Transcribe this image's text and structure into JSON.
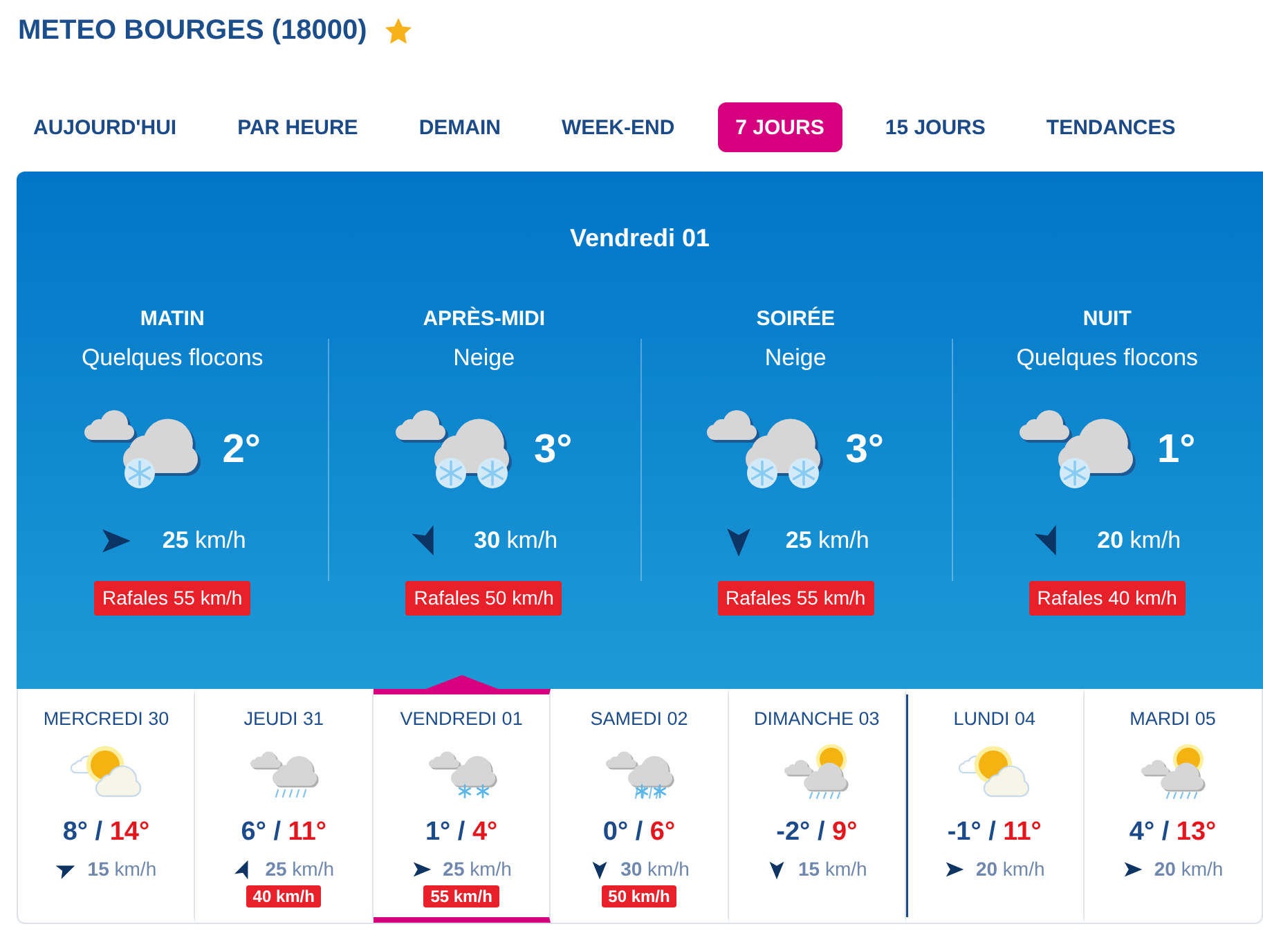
{
  "title": "METEO BOURGES (18000)",
  "tabs": [
    {
      "label": "AUJOURD'HUI",
      "selected": false
    },
    {
      "label": "PAR HEURE",
      "selected": false
    },
    {
      "label": "DEMAIN",
      "selected": false
    },
    {
      "label": "WEEK-END",
      "selected": false
    },
    {
      "label": "7 JOURS",
      "selected": true
    },
    {
      "label": "15 JOURS",
      "selected": false
    },
    {
      "label": "TENDANCES",
      "selected": false
    }
  ],
  "detail": {
    "heading": "Vendredi 01",
    "periods": [
      {
        "label": "MATIN",
        "description": "Quelques flocons",
        "kind": "flurries",
        "temperature": "2°",
        "wind": {
          "kind": "e",
          "speed": "**25** km/h"
        },
        "gust": "Rafales 55 km/h"
      },
      {
        "label": "APRÈS-MIDI",
        "description": "Neige",
        "kind": "snow",
        "temperature": "3°",
        "wind": {
          "kind": "sse",
          "speed": "**30** km/h"
        },
        "gust": "Rafales 50 km/h"
      },
      {
        "label": "SOIRÉE",
        "description": "Neige",
        "kind": "snow",
        "temperature": "3°",
        "wind": {
          "kind": "s",
          "speed": "**25** km/h"
        },
        "gust": "Rafales 55 km/h"
      },
      {
        "label": "NUIT",
        "description": "Quelques flocons",
        "kind": "flurries",
        "temperature": "1°",
        "wind": {
          "kind": "sse",
          "speed": "**20** km/h"
        },
        "gust": "Rafales 40 km/h"
      }
    ]
  },
  "days": [
    {
      "name": "MERCREDI 30",
      "kind": "partly",
      "low": "8°",
      "sep": "/",
      "high": "14°",
      "wind": {
        "kind": "ene",
        "speed": "**15** km/h"
      },
      "selected": false,
      "week_start": false
    },
    {
      "name": "JEUDI 31",
      "kind": "rain",
      "low": "6°",
      "sep": "/",
      "high": "11°",
      "wind": {
        "kind": "nne",
        "speed": "**25** km/h"
      },
      "gust": "40 km/h",
      "selected": false,
      "week_start": false
    },
    {
      "name": "VENDREDI 01",
      "kind": "snow",
      "low": "1°",
      "sep": "/",
      "high": "4°",
      "wind": {
        "kind": "e",
        "speed": "**25** km/h"
      },
      "gust": "55 km/h",
      "selected": true,
      "week_start": false
    },
    {
      "name": "SAMEDI 02",
      "kind": "sleet",
      "low": "0°",
      "sep": "/",
      "high": "6°",
      "wind": {
        "kind": "s",
        "speed": "**30** km/h"
      },
      "gust": "50 km/h",
      "selected": false,
      "week_start": false
    },
    {
      "name": "DIMANCHE 03",
      "kind": "showers",
      "low": "-2°",
      "sep": "/",
      "high": "9°",
      "wind": {
        "kind": "s",
        "speed": "**15** km/h"
      },
      "selected": false,
      "week_start": false
    },
    {
      "name": "LUNDI 04",
      "kind": "partly",
      "low": "-1°",
      "sep": "/",
      "high": "11°",
      "wind": {
        "kind": "e",
        "speed": "**20** km/h"
      },
      "selected": false,
      "week_start": true
    },
    {
      "name": "MARDI 05",
      "kind": "showers",
      "low": "4°",
      "sep": "/",
      "high": "13°",
      "wind": {
        "kind": "e",
        "speed": "**20** km/h"
      },
      "selected": false,
      "week_start": false
    }
  ]
}
